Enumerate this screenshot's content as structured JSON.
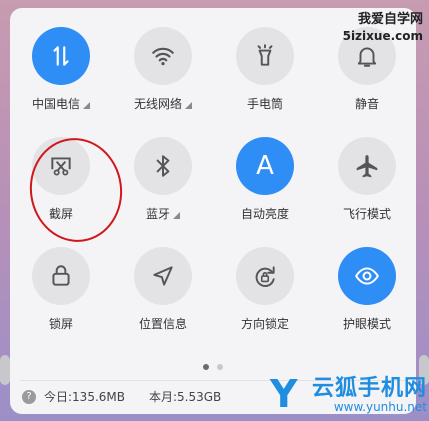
{
  "watermark": {
    "site_cn": "我爱自学网",
    "site_url": "5izixue.com",
    "brand_cn": "云狐手机网",
    "brand_url": "www.yunhu.net",
    "brand_logo": "Y"
  },
  "tiles": [
    {
      "label": "中国电信",
      "icon": "data-arrows-icon",
      "active": true,
      "expand": true
    },
    {
      "label": "无线网络",
      "icon": "wifi-icon",
      "active": false,
      "expand": true
    },
    {
      "label": "手电筒",
      "icon": "flashlight-icon",
      "active": false,
      "expand": false
    },
    {
      "label": "静音",
      "icon": "bell-icon",
      "active": false,
      "expand": false
    },
    {
      "label": "截屏",
      "icon": "scissors-icon",
      "active": false,
      "expand": false
    },
    {
      "label": "蓝牙",
      "icon": "bluetooth-icon",
      "active": false,
      "expand": true
    },
    {
      "label": "自动亮度",
      "icon": "auto-brightness-icon",
      "active": true,
      "expand": false,
      "glyph": "A"
    },
    {
      "label": "飞行模式",
      "icon": "airplane-icon",
      "active": false,
      "expand": false
    },
    {
      "label": "锁屏",
      "icon": "lock-icon",
      "active": false,
      "expand": false
    },
    {
      "label": "位置信息",
      "icon": "location-icon",
      "active": false,
      "expand": false
    },
    {
      "label": "方向锁定",
      "icon": "rotation-lock-icon",
      "active": false,
      "expand": false
    },
    {
      "label": "护眼模式",
      "icon": "eye-icon",
      "active": true,
      "expand": false
    }
  ],
  "footer": {
    "today": "今日:135.6MB",
    "month": "本月:5.53GB"
  },
  "colors": {
    "accent": "#2e8ef5",
    "highlight_ring": "#d0181c"
  },
  "pager": {
    "pages": 2,
    "current": 1
  }
}
